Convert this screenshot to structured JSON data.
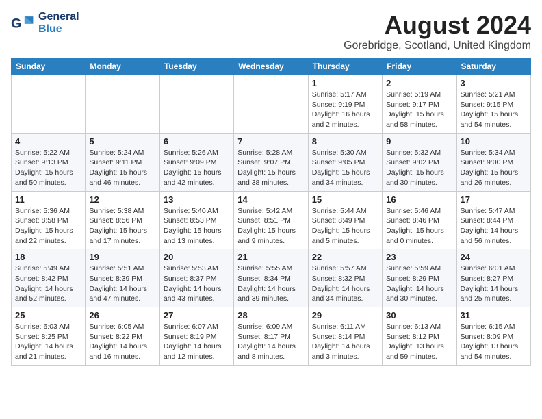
{
  "logo": {
    "line1": "General",
    "line2": "Blue"
  },
  "title": "August 2024",
  "location": "Gorebridge, Scotland, United Kingdom",
  "weekdays": [
    "Sunday",
    "Monday",
    "Tuesday",
    "Wednesday",
    "Thursday",
    "Friday",
    "Saturday"
  ],
  "rows": [
    [
      {
        "day": "",
        "info": ""
      },
      {
        "day": "",
        "info": ""
      },
      {
        "day": "",
        "info": ""
      },
      {
        "day": "",
        "info": ""
      },
      {
        "day": "1",
        "info": "Sunrise: 5:17 AM\nSunset: 9:19 PM\nDaylight: 16 hours\nand 2 minutes."
      },
      {
        "day": "2",
        "info": "Sunrise: 5:19 AM\nSunset: 9:17 PM\nDaylight: 15 hours\nand 58 minutes."
      },
      {
        "day": "3",
        "info": "Sunrise: 5:21 AM\nSunset: 9:15 PM\nDaylight: 15 hours\nand 54 minutes."
      }
    ],
    [
      {
        "day": "4",
        "info": "Sunrise: 5:22 AM\nSunset: 9:13 PM\nDaylight: 15 hours\nand 50 minutes."
      },
      {
        "day": "5",
        "info": "Sunrise: 5:24 AM\nSunset: 9:11 PM\nDaylight: 15 hours\nand 46 minutes."
      },
      {
        "day": "6",
        "info": "Sunrise: 5:26 AM\nSunset: 9:09 PM\nDaylight: 15 hours\nand 42 minutes."
      },
      {
        "day": "7",
        "info": "Sunrise: 5:28 AM\nSunset: 9:07 PM\nDaylight: 15 hours\nand 38 minutes."
      },
      {
        "day": "8",
        "info": "Sunrise: 5:30 AM\nSunset: 9:05 PM\nDaylight: 15 hours\nand 34 minutes."
      },
      {
        "day": "9",
        "info": "Sunrise: 5:32 AM\nSunset: 9:02 PM\nDaylight: 15 hours\nand 30 minutes."
      },
      {
        "day": "10",
        "info": "Sunrise: 5:34 AM\nSunset: 9:00 PM\nDaylight: 15 hours\nand 26 minutes."
      }
    ],
    [
      {
        "day": "11",
        "info": "Sunrise: 5:36 AM\nSunset: 8:58 PM\nDaylight: 15 hours\nand 22 minutes."
      },
      {
        "day": "12",
        "info": "Sunrise: 5:38 AM\nSunset: 8:56 PM\nDaylight: 15 hours\nand 17 minutes."
      },
      {
        "day": "13",
        "info": "Sunrise: 5:40 AM\nSunset: 8:53 PM\nDaylight: 15 hours\nand 13 minutes."
      },
      {
        "day": "14",
        "info": "Sunrise: 5:42 AM\nSunset: 8:51 PM\nDaylight: 15 hours\nand 9 minutes."
      },
      {
        "day": "15",
        "info": "Sunrise: 5:44 AM\nSunset: 8:49 PM\nDaylight: 15 hours\nand 5 minutes."
      },
      {
        "day": "16",
        "info": "Sunrise: 5:46 AM\nSunset: 8:46 PM\nDaylight: 15 hours\nand 0 minutes."
      },
      {
        "day": "17",
        "info": "Sunrise: 5:47 AM\nSunset: 8:44 PM\nDaylight: 14 hours\nand 56 minutes."
      }
    ],
    [
      {
        "day": "18",
        "info": "Sunrise: 5:49 AM\nSunset: 8:42 PM\nDaylight: 14 hours\nand 52 minutes."
      },
      {
        "day": "19",
        "info": "Sunrise: 5:51 AM\nSunset: 8:39 PM\nDaylight: 14 hours\nand 47 minutes."
      },
      {
        "day": "20",
        "info": "Sunrise: 5:53 AM\nSunset: 8:37 PM\nDaylight: 14 hours\nand 43 minutes."
      },
      {
        "day": "21",
        "info": "Sunrise: 5:55 AM\nSunset: 8:34 PM\nDaylight: 14 hours\nand 39 minutes."
      },
      {
        "day": "22",
        "info": "Sunrise: 5:57 AM\nSunset: 8:32 PM\nDaylight: 14 hours\nand 34 minutes."
      },
      {
        "day": "23",
        "info": "Sunrise: 5:59 AM\nSunset: 8:29 PM\nDaylight: 14 hours\nand 30 minutes."
      },
      {
        "day": "24",
        "info": "Sunrise: 6:01 AM\nSunset: 8:27 PM\nDaylight: 14 hours\nand 25 minutes."
      }
    ],
    [
      {
        "day": "25",
        "info": "Sunrise: 6:03 AM\nSunset: 8:25 PM\nDaylight: 14 hours\nand 21 minutes."
      },
      {
        "day": "26",
        "info": "Sunrise: 6:05 AM\nSunset: 8:22 PM\nDaylight: 14 hours\nand 16 minutes."
      },
      {
        "day": "27",
        "info": "Sunrise: 6:07 AM\nSunset: 8:19 PM\nDaylight: 14 hours\nand 12 minutes."
      },
      {
        "day": "28",
        "info": "Sunrise: 6:09 AM\nSunset: 8:17 PM\nDaylight: 14 hours\nand 8 minutes."
      },
      {
        "day": "29",
        "info": "Sunrise: 6:11 AM\nSunset: 8:14 PM\nDaylight: 14 hours\nand 3 minutes."
      },
      {
        "day": "30",
        "info": "Sunrise: 6:13 AM\nSunset: 8:12 PM\nDaylight: 13 hours\nand 59 minutes."
      },
      {
        "day": "31",
        "info": "Sunrise: 6:15 AM\nSunset: 8:09 PM\nDaylight: 13 hours\nand 54 minutes."
      }
    ]
  ]
}
